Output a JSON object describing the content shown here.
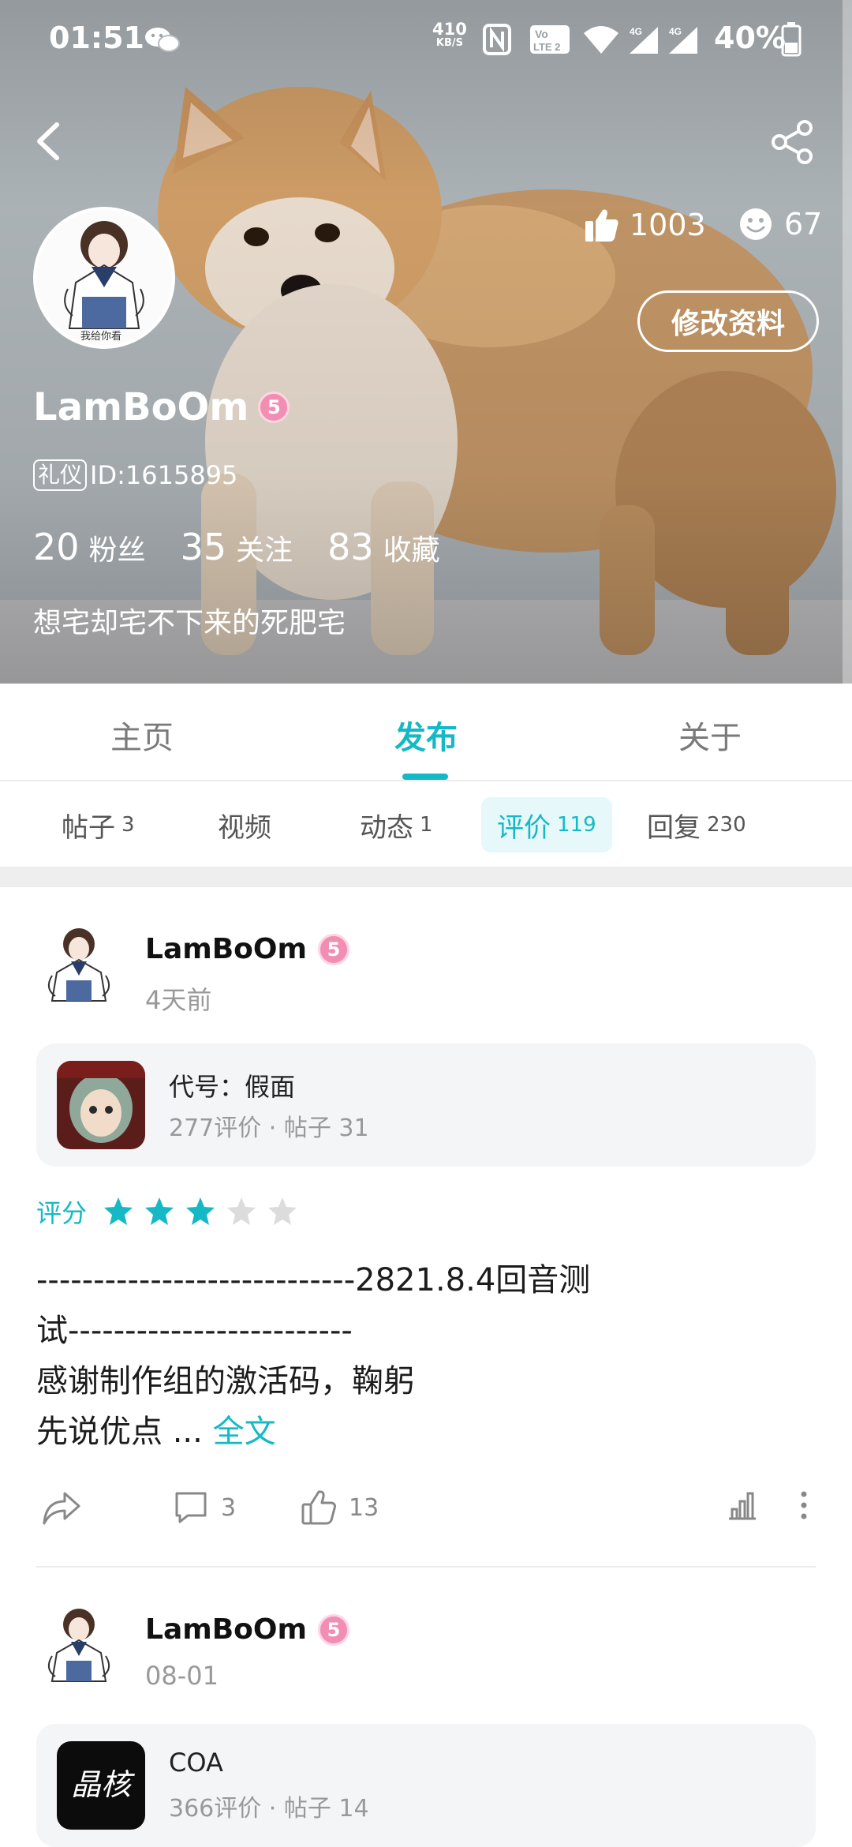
{
  "status_bar": {
    "time": "01:51",
    "net_speed": "410",
    "net_unit": "KB/S",
    "battery": "40%",
    "icons": [
      "wechat-icon",
      "nfc-icon",
      "volte-icon",
      "wifi-icon",
      "signal-4g-icon",
      "signal-4g-icon",
      "battery-icon"
    ]
  },
  "header": {
    "back_icon": "chevron-left-icon",
    "share_icon": "share-icon",
    "likes": "1003",
    "smiles": "67",
    "edit_button": "修改资料",
    "username": "LamBoOm",
    "level": "5",
    "id_tag": "礼仪",
    "id_text": "ID:1615895",
    "counts": [
      {
        "num": "20",
        "label": "粉丝"
      },
      {
        "num": "35",
        "label": "关注"
      },
      {
        "num": "83",
        "label": "收藏"
      }
    ],
    "bio": "想宅却宅不下来的死肥宅",
    "avatar_caption": "我给你看"
  },
  "main_tabs": [
    {
      "label": "主页"
    },
    {
      "label": "发布"
    },
    {
      "label": "关于"
    }
  ],
  "active_main_tab": "发布",
  "sub_tabs": [
    {
      "label": "帖子",
      "count": "3"
    },
    {
      "label": "视频",
      "count": ""
    },
    {
      "label": "动态",
      "count": "1"
    },
    {
      "label": "评价",
      "count": "119"
    },
    {
      "label": "回复",
      "count": "230"
    }
  ],
  "active_sub_tab": "评价",
  "posts": [
    {
      "author": "LamBoOm",
      "level": "5",
      "time": "4天前",
      "game": {
        "name": "代号：假面",
        "meta": "277评价 · 帖子 31"
      },
      "rating_label": "评分",
      "rating": 3,
      "rating_max": 5,
      "text_lines": [
        "----------------------------2821.8.4回音测",
        "试-------------------------",
        "感谢制作组的激活码，鞠躬",
        "先说优点 ..."
      ],
      "more_link": "全文",
      "comments": "3",
      "likes": "13"
    },
    {
      "author": "LamBoOm",
      "level": "5",
      "time": "08-01",
      "game": {
        "name": "COA",
        "meta": "366评价 · 帖子 14",
        "logo_text": "晶核"
      }
    }
  ],
  "colors": {
    "accent": "#15b9c6",
    "star_empty": "#dcdcdc",
    "level_badge": "#f28eb2"
  }
}
